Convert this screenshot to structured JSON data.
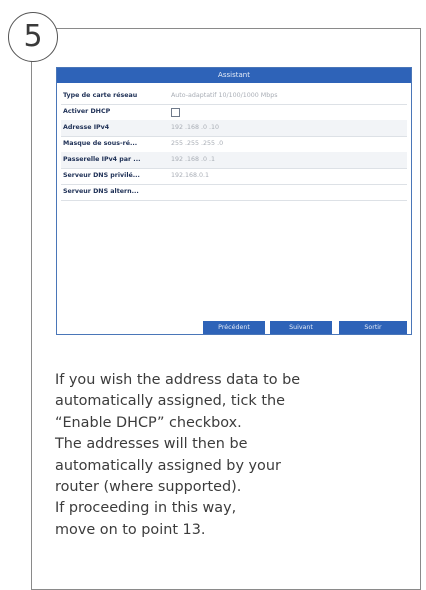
{
  "step_number": "5",
  "dialog": {
    "title": "Assistant",
    "rows": [
      {
        "label": "Type de carte réseau",
        "value": "Auto-adaptatif 10/100/1000 Mbps"
      },
      {
        "label": "Activer DHCP",
        "checked": false
      },
      {
        "label": "Adresse IPv4",
        "value": "192 .168 .0     .10"
      },
      {
        "label": "Masque de sous-ré...",
        "value": "255 .255 .255 .0"
      },
      {
        "label": "Passerelle IPv4 par ...",
        "value": "192 .168 .0     .1"
      },
      {
        "label": "Serveur DNS privilé...",
        "value": "192.168.0.1"
      },
      {
        "label": "Serveur DNS altern...",
        "value": ""
      }
    ],
    "buttons": {
      "previous": "Précédent",
      "next": "Suivant",
      "exit": "Sortir"
    }
  },
  "description_lines": [
    "If you wish the address data to be",
    "automatically assigned, tick the",
    "“Enable DHCP” checkbox.",
    "The addresses will then be",
    "automatically assigned by your",
    "router (where supported).",
    "If proceeding in this way,",
    "move on to point 13."
  ],
  "colors": {
    "titlebar": "#2e63b8",
    "button": "#2e63b8",
    "label_text": "#1d2f55",
    "value_text": "#a8adb5"
  }
}
